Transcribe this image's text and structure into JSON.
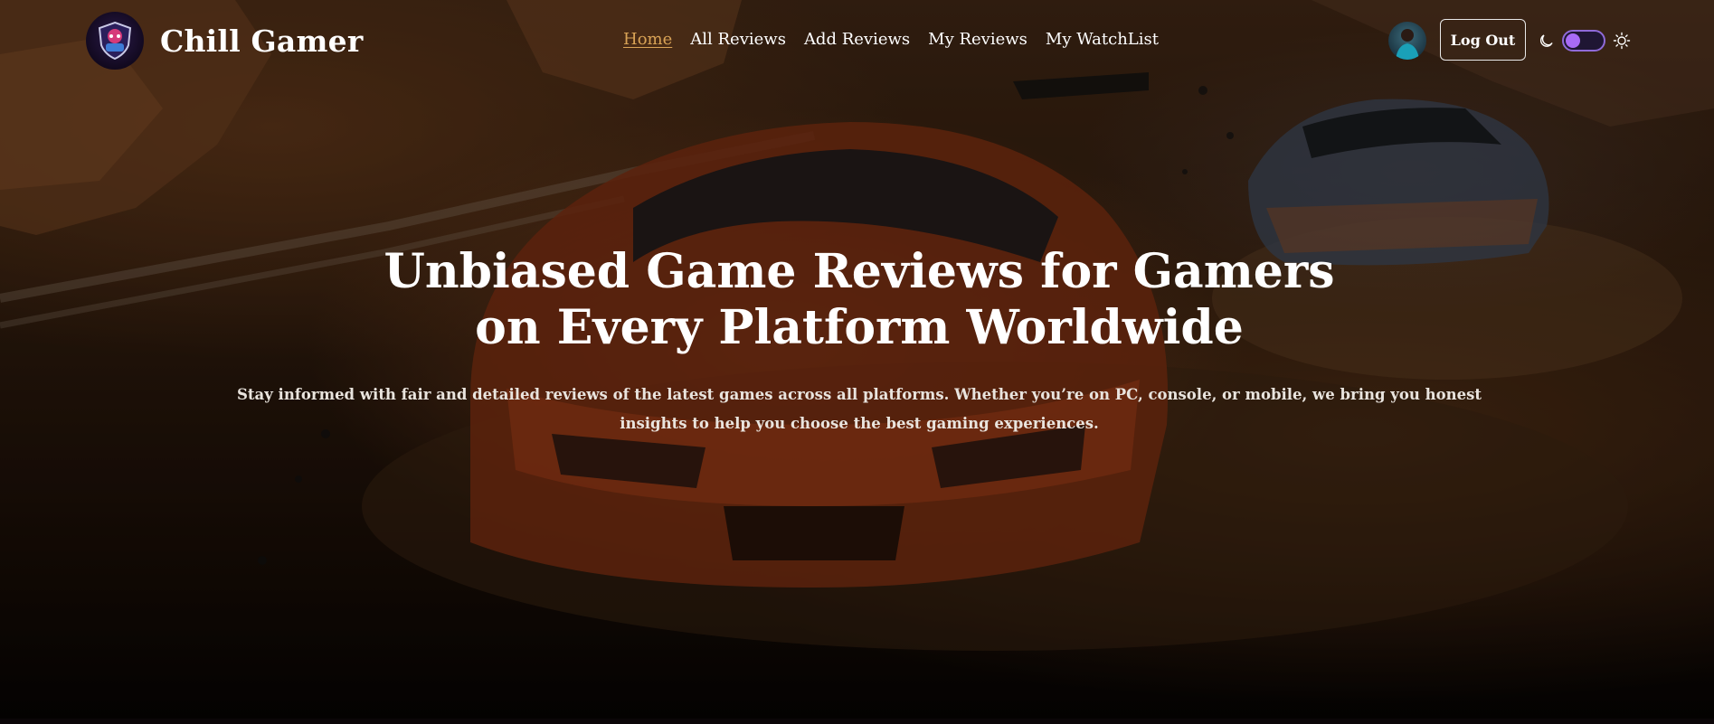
{
  "brand": {
    "name": "Chill Gamer",
    "logo_icon": "gamer-shield-logo-icon"
  },
  "nav": {
    "items": [
      {
        "label": "Home",
        "active": true
      },
      {
        "label": "All Reviews",
        "active": false
      },
      {
        "label": "Add Reviews",
        "active": false
      },
      {
        "label": "My Reviews",
        "active": false
      },
      {
        "label": "My WatchList",
        "active": false
      }
    ]
  },
  "user": {
    "avatar_icon": "user-avatar"
  },
  "auth": {
    "logout_label": "Log Out"
  },
  "theme": {
    "dark_icon": "moon-icon",
    "light_icon": "sun-icon",
    "toggle_state": "dark",
    "accent": "#a86bf5"
  },
  "hero": {
    "title_line1": "Unbiased Game Reviews for Gamers",
    "title_line2": "on Every Platform Worldwide",
    "subtitle": "Stay informed with fair and detailed reviews of the latest games across all platforms. Whether you’re on PC, console, or mobile, we bring you honest insights to help you choose the best gaming experiences.",
    "background": "rally-car-racing-image"
  },
  "colors": {
    "active_link": "#d9a356",
    "text": "#ffffff"
  }
}
